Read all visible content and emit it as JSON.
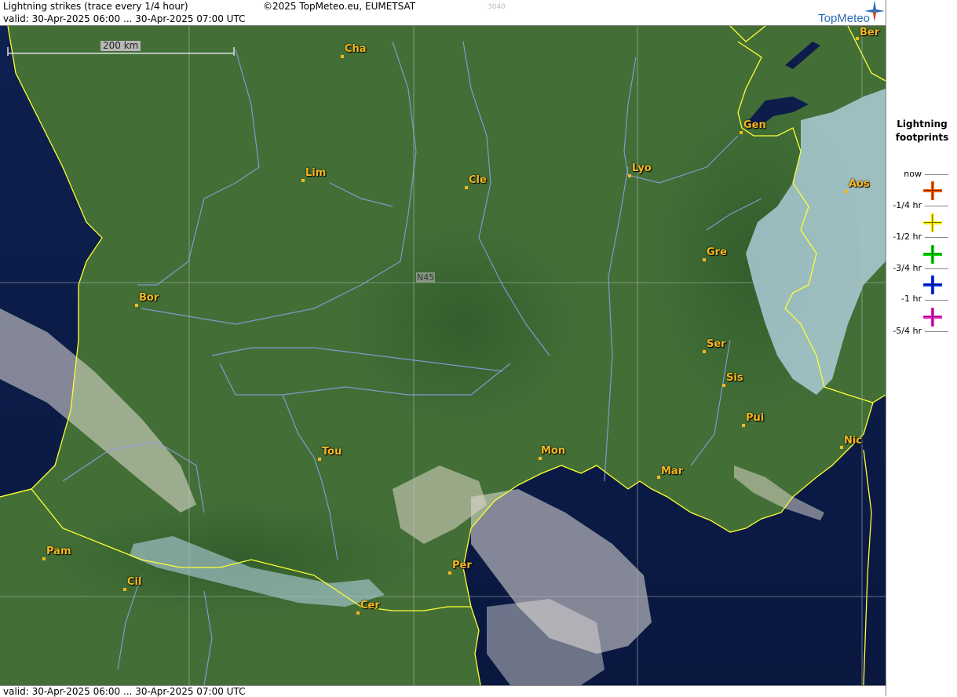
{
  "header": {
    "title": "Lightning strikes (trace every 1/4 hour)",
    "copyright": "©2025 TopMeteo.eu, EUMETSAT",
    "code": "3040",
    "valid": "valid:  30-Apr-2025 06:00 ... 30-Apr-2025 07:00 UTC",
    "logo": "TopMeteo"
  },
  "footer": {
    "valid": "valid:  30-Apr-2025 06:00 ... 30-Apr-2025 07:00 UTC"
  },
  "scale": {
    "label": "200 km"
  },
  "grid": {
    "lat_label": "N45"
  },
  "legend": {
    "title_line1": "Lightning",
    "title_line2": "footprints",
    "items": [
      {
        "label": "now",
        "color": "#ff5a00",
        "icon": "orange-cross-icon"
      },
      {
        "label": "-1/4 hr",
        "color": "#ffee00",
        "icon": "yellow-cross-icon"
      },
      {
        "label": "-1/2 hr",
        "color": "#00dd00",
        "icon": "green-cross-icon"
      },
      {
        "label": "-3/4 hr",
        "color": "#0033ff",
        "icon": "blue-cross-icon"
      },
      {
        "label": "-1 hr",
        "color": "#ee22cc",
        "icon": "magenta-cross-icon"
      },
      {
        "label": "-5/4 hr",
        "color": "",
        "icon": ""
      }
    ]
  },
  "cities": [
    {
      "name": "Cha"
    },
    {
      "name": "Ber"
    },
    {
      "name": "Gen"
    },
    {
      "name": "Lim"
    },
    {
      "name": "Cle"
    },
    {
      "name": "Lyo"
    },
    {
      "name": "Aos"
    },
    {
      "name": "Gre"
    },
    {
      "name": "Bor"
    },
    {
      "name": "Ser"
    },
    {
      "name": "Sis"
    },
    {
      "name": "Pui"
    },
    {
      "name": "Tou"
    },
    {
      "name": "Mon"
    },
    {
      "name": "Mar"
    },
    {
      "name": "Nic"
    },
    {
      "name": "Pam"
    },
    {
      "name": "Cil"
    },
    {
      "name": "Per"
    },
    {
      "name": "Cer"
    }
  ],
  "colors": {
    "land": "#3f6b33",
    "sea": "#0d1c4a",
    "coast": "#ffff33",
    "river": "#8fa0e8",
    "city": "#f5b820",
    "snow": "#bcd9ee"
  }
}
